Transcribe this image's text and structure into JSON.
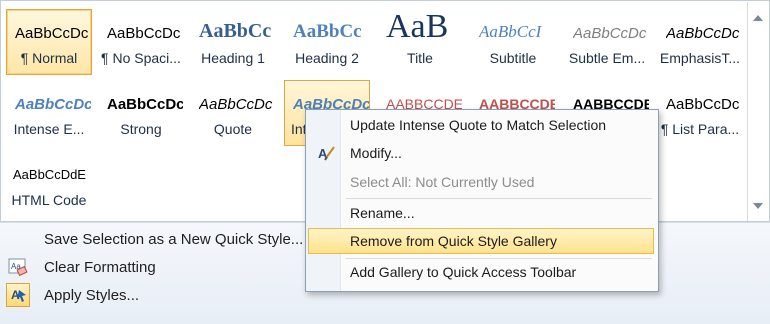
{
  "gallery": {
    "tiles": [
      {
        "preview": "AaBbCcDc",
        "label": "¶ Normal",
        "color": "#000000"
      },
      {
        "preview": "AaBbCcDc",
        "label": "¶ No Spaci...",
        "color": "#000000"
      },
      {
        "preview": "AaBbCc",
        "label": "Heading 1",
        "color": "#365f91"
      },
      {
        "preview": "AaBbCc",
        "label": "Heading 2",
        "color": "#4f81bd"
      },
      {
        "preview": "AaB",
        "label": "Title",
        "color": "#17365d"
      },
      {
        "preview": "AaBbCcI",
        "label": "Subtitle",
        "color": "#4f81bd"
      },
      {
        "preview": "AaBbCcDc",
        "label": "Subtle Em...",
        "color": "#7f7f7f"
      },
      {
        "preview": "AaBbCcDc",
        "label": "EmphasisT...",
        "color": "#000000"
      },
      {
        "preview": "AaBbCcDc",
        "label": "Intense E...",
        "color": "#4f81bd"
      },
      {
        "preview": "AaBbCcDc",
        "label": "Strong",
        "color": "#000000"
      },
      {
        "preview": "AaBbCcDc",
        "label": "Quote",
        "color": "#000000"
      },
      {
        "preview": "AaBbCcDc",
        "label": "Inte...",
        "color": "#4f81bd"
      },
      {
        "preview": "AABBCCDE",
        "label": "",
        "color": "#c0504d"
      },
      {
        "preview": "AABBCCDE",
        "label": "",
        "color": "#c0504d"
      },
      {
        "preview": "AABBCCDE",
        "label": "",
        "color": "#000000"
      },
      {
        "preview": "AaBbCcDc",
        "label": "¶ List Para...",
        "color": "#000000"
      },
      {
        "preview": "AaBbCcDdE",
        "label": "HTML Code",
        "color": "#000000"
      }
    ],
    "scroll_up_icon": "triangle-up",
    "scroll_down_icon": "triangle-down",
    "scroll_more_icon": "triangle-down-bar"
  },
  "footer": {
    "save_selection": "Save Selection as a New Quick Style...",
    "clear_formatting": "Clear Formatting",
    "apply_styles": "Apply Styles..."
  },
  "context_menu": {
    "update": "Update Intense Quote to Match Selection",
    "modify": "Modify...",
    "select_all": "Select All: Not Currently Used",
    "rename": "Rename...",
    "remove": "Remove from Quick Style Gallery",
    "add_gallery": "Add Gallery to Quick Access Toolbar"
  },
  "colors": {
    "accent_border": "#e8a341",
    "highlight": "#ffe28b",
    "heading_blue": "#4f81bd"
  }
}
